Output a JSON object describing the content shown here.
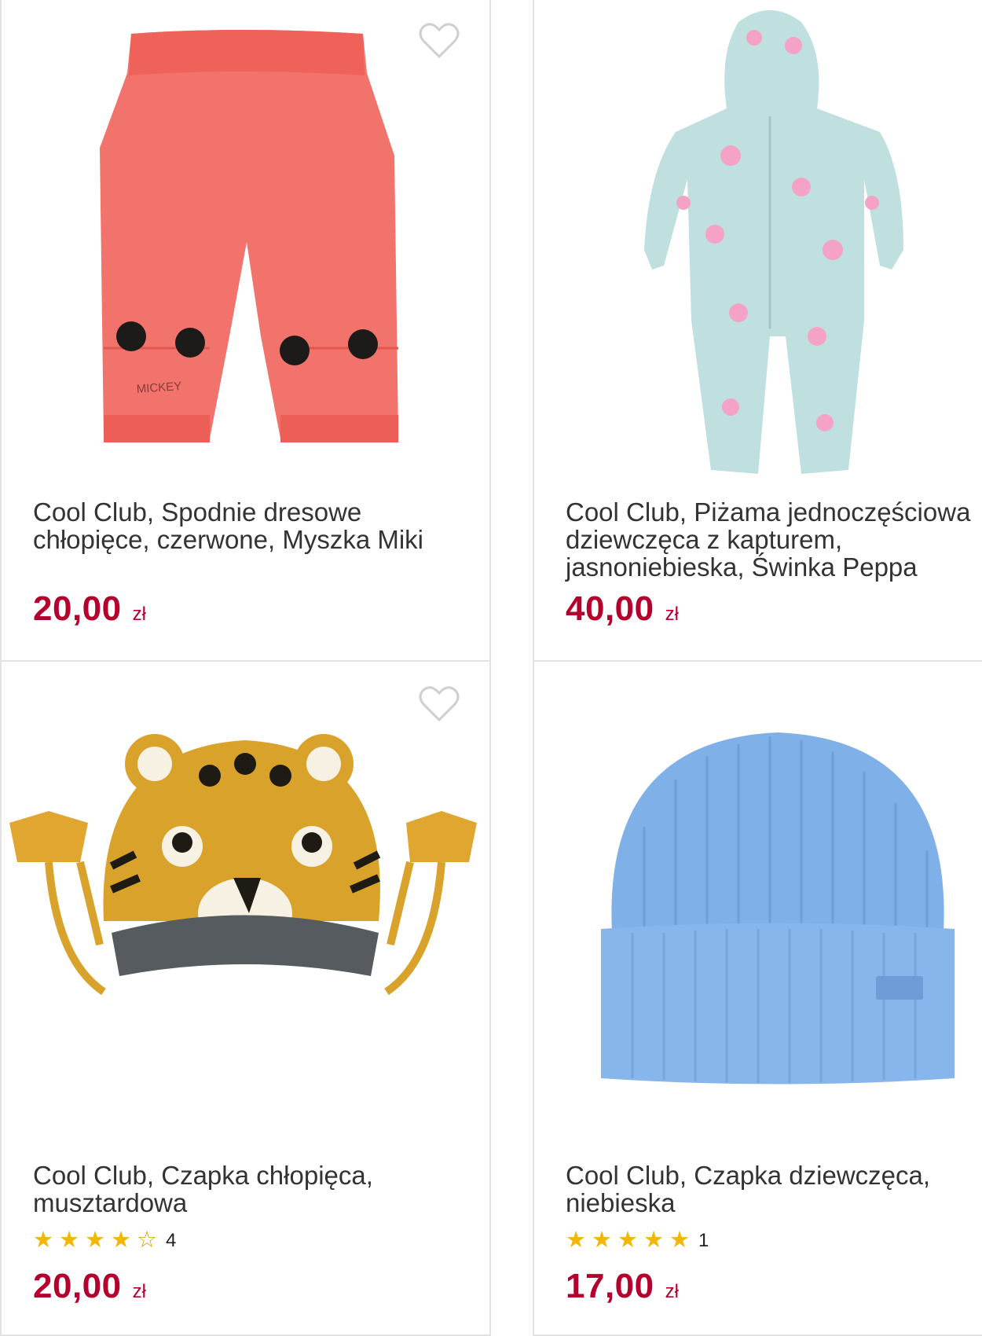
{
  "products": [
    {
      "title": "Cool Club, Spodnie dresowe chłopięce, czerwone, Myszka Miki",
      "image_text": "MICKEY",
      "price": "20,00",
      "currency": "zł",
      "wishlist_icon": "heart-outline-icon"
    },
    {
      "title": "Cool Club, Piżama jednoczęściowa dziewczęca z kapturem, jasnoniebieska, Świnka Peppa",
      "price": "40,00",
      "currency": "zł",
      "wishlist_icon": "heart-outline-icon"
    },
    {
      "title": "Cool Club, Czapka chłopięca, musztardowa",
      "rating": {
        "stars": 4,
        "max": 5,
        "count": "4"
      },
      "price": "20,00",
      "currency": "zł",
      "wishlist_icon": "heart-outline-icon"
    },
    {
      "title": "Cool Club, Czapka dziewczęca, niebieska",
      "rating": {
        "stars": 5,
        "max": 5,
        "count": "1"
      },
      "price": "17,00",
      "currency": "zł",
      "wishlist_icon": "heart-outline-icon"
    }
  ],
  "colors": {
    "price": "#b5002e",
    "star": "#f2b705",
    "border": "#e3e3e3",
    "title": "#333333"
  }
}
